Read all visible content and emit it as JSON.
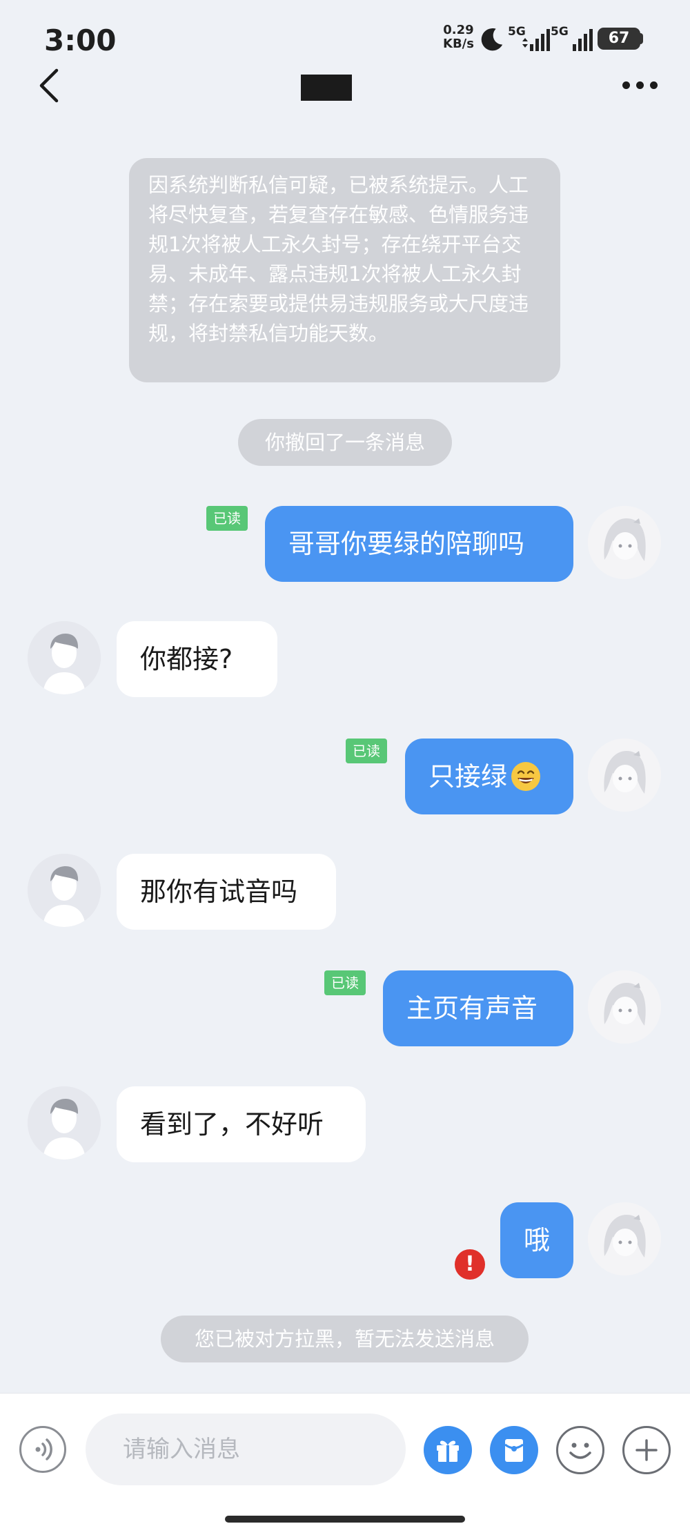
{
  "status_bar": {
    "time": "3:00",
    "net_speed_value": "0.29",
    "net_speed_unit": "KB/s",
    "signal_1_label": "5G",
    "signal_2_label": "5G",
    "battery": "67"
  },
  "system_notice": "因系统判断私信可疑，已被系统提示。人工将尽快复查，若复查存在敏感、色情服务违规1次将被人工永久封号；存在绕开平台交易、未成年、露点违规1次将被人工永久封禁；存在索要或提供易违规服务或大尺度违规，将封禁私信功能天数。",
  "recall_notice": "你撤回了一条消息",
  "read_label": "已读",
  "messages": [
    {
      "sender": "self",
      "text": "哥哥你要绿的陪聊吗",
      "read": true
    },
    {
      "sender": "other",
      "text": "你都接?"
    },
    {
      "sender": "self",
      "text": "只接绿",
      "emoji": "grinning-face-emoji",
      "read": true
    },
    {
      "sender": "other",
      "text": "那你有试音吗"
    },
    {
      "sender": "self",
      "text": "主页有声音",
      "read": true
    },
    {
      "sender": "other",
      "text": "看到了，不好听"
    },
    {
      "sender": "self",
      "text": "哦",
      "failed": true
    }
  ],
  "error_mark": "!",
  "blocked_notice": "您已被对方拉黑，暂无法发送消息",
  "input": {
    "placeholder": "请输入消息"
  },
  "icons": [
    "back-icon",
    "more-icon",
    "moon-icon",
    "voice-icon",
    "gift-icon",
    "red-packet-icon",
    "emoji-icon",
    "plus-icon",
    "error-icon"
  ],
  "colors": {
    "self_bubble": "#4a95f2",
    "read_badge": "#58c776",
    "notice_bg": "#d1d3d8",
    "error": "#e0302a"
  }
}
